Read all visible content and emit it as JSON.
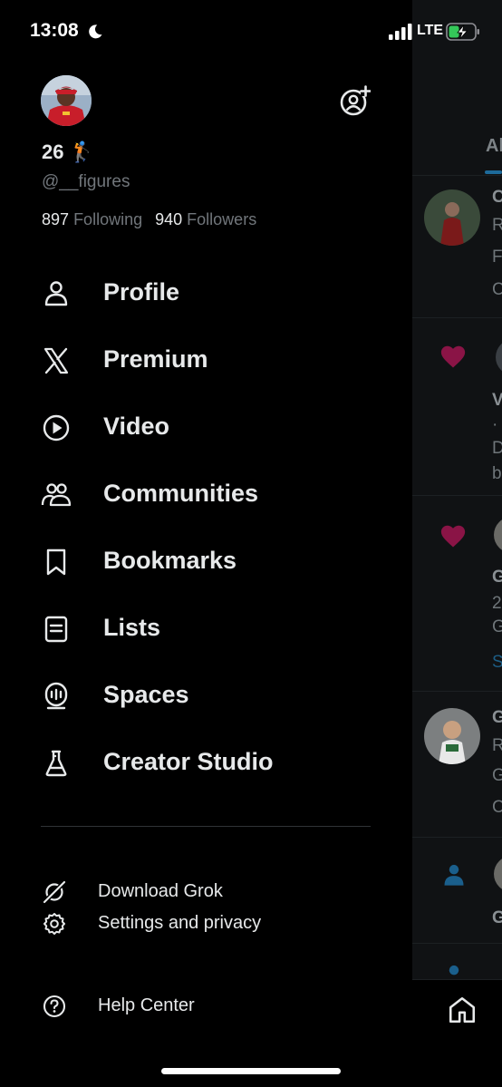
{
  "status_bar": {
    "time": "13:08",
    "network": "LTE"
  },
  "profile": {
    "display_name": "26 🏌",
    "handle": "@__figures",
    "following_count": "897",
    "following_label": "Following",
    "followers_count": "940",
    "followers_label": "Followers"
  },
  "nav": {
    "items": [
      {
        "label": "Profile",
        "icon": "person-icon"
      },
      {
        "label": "Premium",
        "icon": "x-logo-icon"
      },
      {
        "label": "Video",
        "icon": "play-circle-icon"
      },
      {
        "label": "Communities",
        "icon": "communities-icon"
      },
      {
        "label": "Bookmarks",
        "icon": "bookmark-icon"
      },
      {
        "label": "Lists",
        "icon": "list-icon"
      },
      {
        "label": "Spaces",
        "icon": "spaces-mic-icon"
      },
      {
        "label": "Creator Studio",
        "icon": "flask-icon"
      }
    ]
  },
  "secondary": {
    "items": [
      {
        "label": "Download Grok",
        "icon": "grok-icon"
      },
      {
        "label": "Settings and privacy",
        "icon": "gear-icon"
      },
      {
        "label": "Help Center",
        "icon": "help-icon"
      }
    ]
  },
  "timeline_peek": {
    "tab": "Al",
    "letters": [
      "C",
      "R",
      "F",
      "C",
      "V",
      "·",
      "D",
      "b",
      "G",
      "2",
      "G",
      "S",
      "G",
      "R",
      "G",
      "C",
      "G"
    ]
  },
  "colors": {
    "background": "#000000",
    "text_primary": "#e7e9ea",
    "text_secondary": "#71767b",
    "heart": "#c0185f",
    "accent": "#1d9bf0",
    "battery": "#34c759"
  }
}
